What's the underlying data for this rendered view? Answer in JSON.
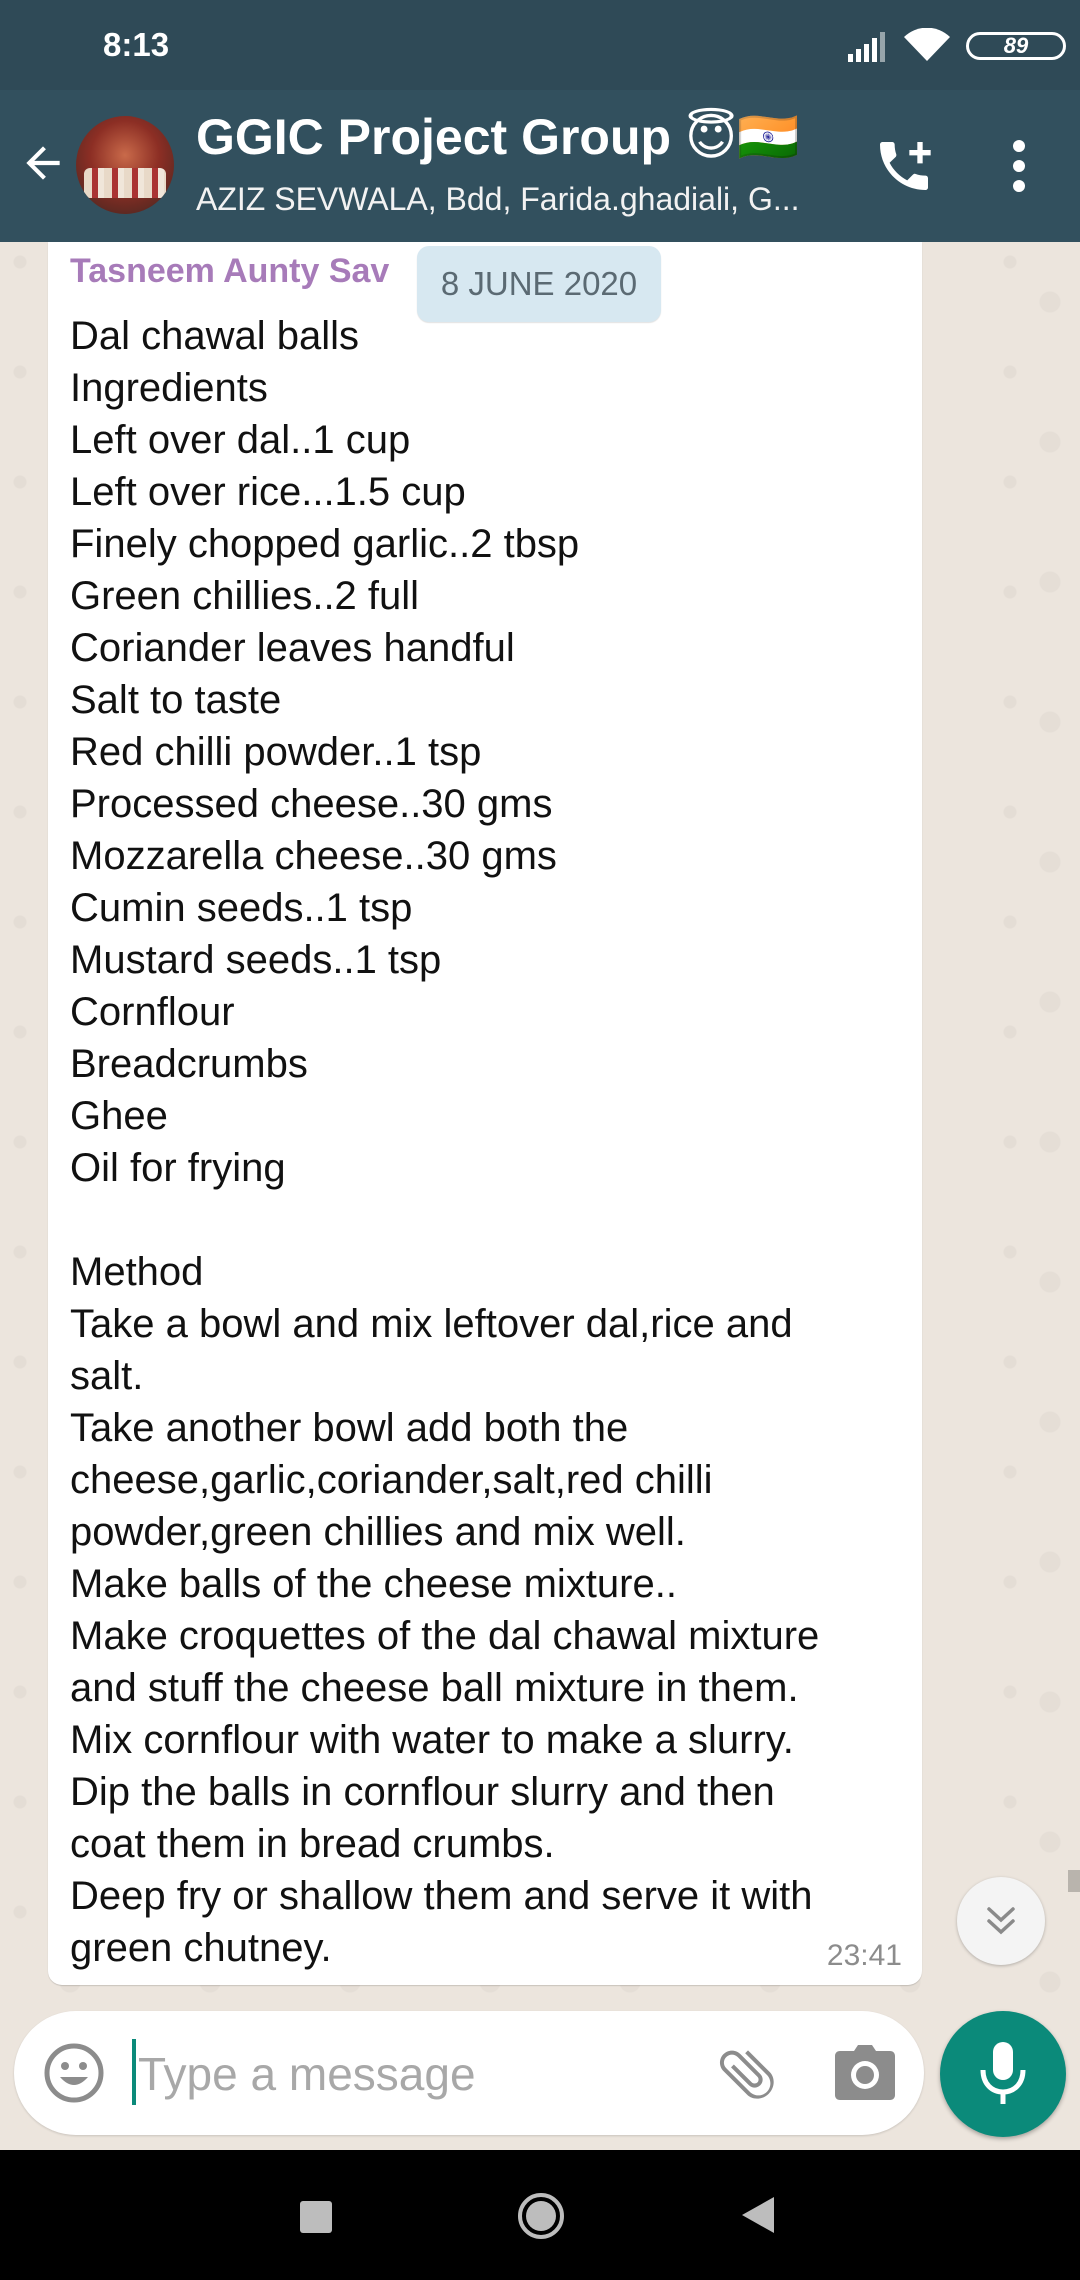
{
  "status_bar": {
    "time": "8:13",
    "battery": "89"
  },
  "header": {
    "group_name": "GGIC Project Group 😇🇮🇳",
    "members": "AZIZ SEVWALA, Bdd, Farida.ghadiali, G..."
  },
  "chat": {
    "date_chip": "8 JUNE 2020",
    "message": {
      "sender": "Tasneem Aunty Sav",
      "time": "23:41",
      "lines": [
        "Dal chawal balls",
        "Ingredients",
        "Left over dal..1 cup",
        "Left over rice...1.5 cup",
        "Finely chopped garlic..2 tbsp",
        "Green chillies..2 full",
        "Coriander leaves handful",
        "Salt to taste",
        "Red chilli powder..1 tsp",
        "Processed cheese..30 gms",
        "Mozzarella cheese..30 gms",
        "Cumin seeds..1 tsp",
        "Mustard seeds..1 tsp",
        "Cornflour",
        "Breadcrumbs",
        "Ghee",
        "Oil for frying",
        "",
        "Method",
        "Take a bowl and mix leftover dal,rice and",
        "salt.",
        "Take another bowl add both the",
        "cheese,garlic,coriander,salt,red chilli",
        "powder,green chillies and mix well.",
        "Make balls of the cheese mixture..",
        "Make croquettes of the dal chawal mixture",
        "and stuff the cheese ball mixture in them.",
        "Mix cornflour with water to make a slurry.",
        "Dip the balls in cornflour slurry and then",
        "coat them in bread crumbs.",
        "Deep fry or shallow them and serve it with",
        "green chutney."
      ]
    }
  },
  "composer": {
    "placeholder": "Type a message"
  },
  "colors": {
    "header": "#32505e",
    "accent": "#0b8a7a",
    "sender": "#a77bb9",
    "date_chip": "#d7e8f1"
  },
  "icons": [
    "back-arrow-icon",
    "add-call-icon",
    "more-vertical-icon",
    "emoji-icon",
    "attach-icon",
    "camera-icon",
    "mic-icon",
    "chevron-double-down-icon"
  ]
}
